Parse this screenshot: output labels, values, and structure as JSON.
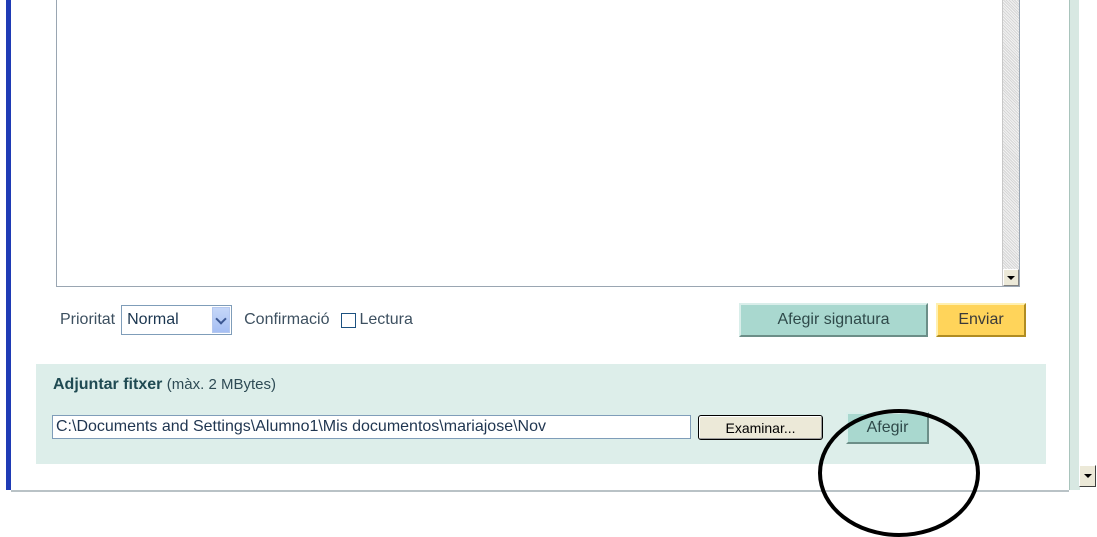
{
  "compose": {
    "priority_label": "Prioritat",
    "priority_value": "Normal",
    "confirmation_label": "Confirmació",
    "read_receipt_label": "Lectura",
    "read_receipt_checked": false,
    "add_signature_label": "Afegir signatura",
    "send_label": "Enviar"
  },
  "attach": {
    "title": "Adjuntar fitxer",
    "limit": "(màx. 2 MBytes)",
    "file_path": "C:\\Documents and Settings\\Alumno1\\Mis documentos\\mariajose\\Nov",
    "browse_label": "Examinar...",
    "add_label": "Afegir"
  },
  "colors": {
    "accent_teal": "#a9d8cf",
    "send_yellow": "#ffd45a",
    "panel_bg": "#ddeeea"
  }
}
